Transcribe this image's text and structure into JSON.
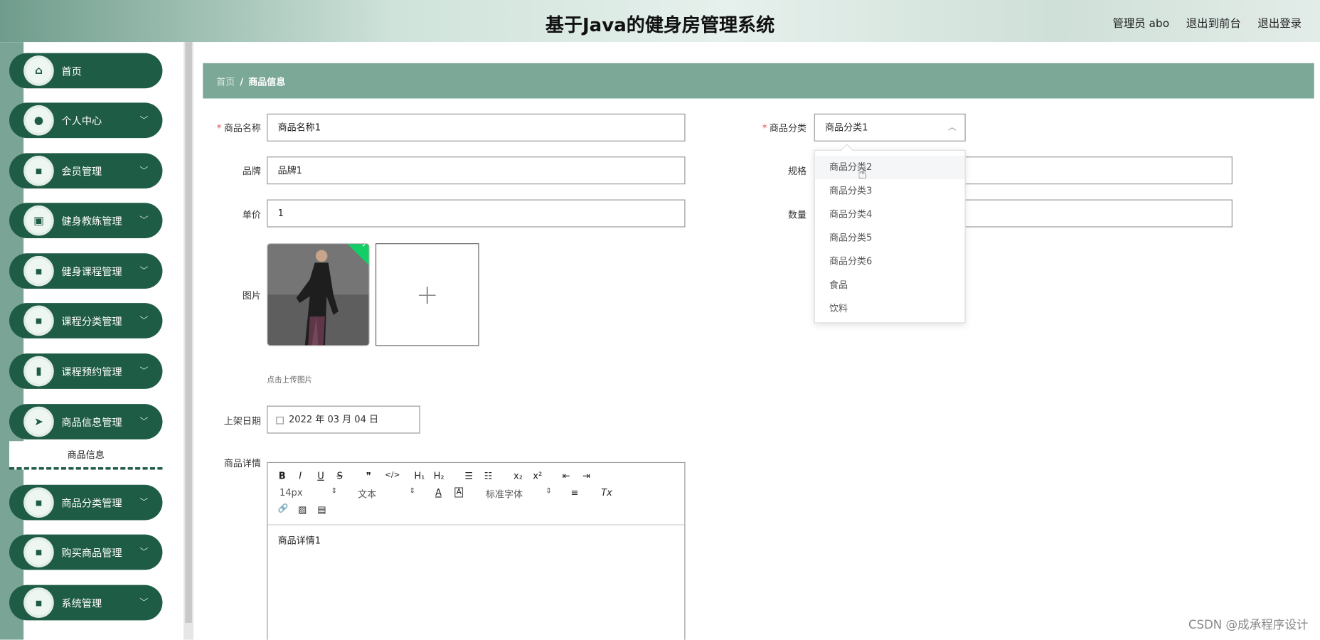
{
  "header": {
    "title": "基于Java的健身房管理系统",
    "admin": "管理员 abo",
    "to_front": "退出到前台",
    "logout": "退出登录"
  },
  "sidebar": {
    "items": [
      {
        "label": "首页",
        "icon": "home-icon",
        "glyph": "⌂"
      },
      {
        "label": "个人中心",
        "icon": "user-icon",
        "glyph": "●"
      },
      {
        "label": "会员管理",
        "icon": "grid-icon",
        "glyph": "▪"
      },
      {
        "label": "健身教练管理",
        "icon": "clipboard-icon",
        "glyph": "▣"
      },
      {
        "label": "健身课程管理",
        "icon": "grid-icon",
        "glyph": "▪"
      },
      {
        "label": "课程分类管理",
        "icon": "grid-icon",
        "glyph": "▪"
      },
      {
        "label": "课程预约管理",
        "icon": "bar-chart-icon",
        "glyph": "▮"
      },
      {
        "label": "商品信息管理",
        "icon": "send-icon",
        "glyph": "➤"
      },
      {
        "label": "商品分类管理",
        "icon": "grid-icon",
        "glyph": "▪"
      },
      {
        "label": "购买商品管理",
        "icon": "grid-icon",
        "glyph": "▪"
      },
      {
        "label": "系统管理",
        "icon": "grid-icon",
        "glyph": "▪"
      }
    ],
    "submenu_label": "商品信息",
    "chevron": "﹀"
  },
  "breadcrumb": {
    "home": "首页",
    "sep": "/",
    "current": "商品信息"
  },
  "form": {
    "name": {
      "label": "商品名称",
      "value": "商品名称1"
    },
    "category": {
      "label": "商品分类",
      "value": "商品分类1",
      "options": [
        "商品分类2",
        "商品分类3",
        "商品分类4",
        "商品分类5",
        "商品分类6",
        "食品",
        "饮料"
      ]
    },
    "brand": {
      "label": "品牌",
      "value": "品牌1"
    },
    "spec": {
      "label": "规格",
      "value": ""
    },
    "price": {
      "label": "单价",
      "value": "1"
    },
    "quantity": {
      "label": "数量",
      "value": ""
    },
    "image": {
      "label": "图片",
      "hint": "点击上传图片"
    },
    "date": {
      "label": "上架日期",
      "value": "2022 年 03 月 04 日"
    },
    "detail": {
      "label": "商品详情",
      "value": "商品详情1"
    }
  },
  "editor_toolbar": {
    "bold": "B",
    "italic": "I",
    "underline": "U",
    "strike": "S",
    "quote": "❞",
    "code": "</>",
    "h1": "H₁",
    "h2": "H₂",
    "ol": "☰",
    "ul": "☷",
    "sub": "x₂",
    "sup": "x²",
    "outdent": "⇤",
    "indent": "⇥",
    "size": "14px",
    "header_select": "文本",
    "font_select": "标准字体",
    "color": "A",
    "bg": "A",
    "align": "≡",
    "clean": "Tx",
    "link": "🔗",
    "image": "▨",
    "video": "▤",
    "updown": "⇕"
  },
  "watermark": "CSDN @成承程序设计"
}
